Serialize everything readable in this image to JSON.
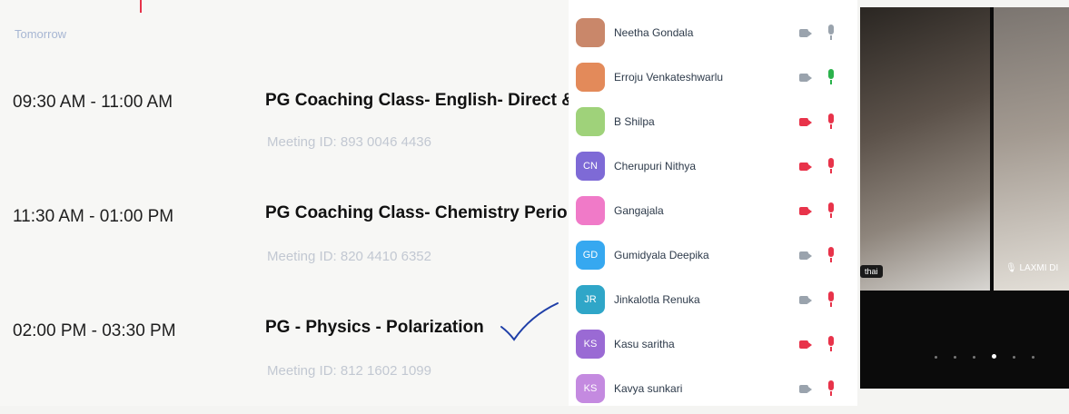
{
  "schedule": {
    "day_label": "Tomorrow",
    "meetings": [
      {
        "time": "09:30 AM - 11:00 AM",
        "title": "PG Coaching Class- English- Direct &",
        "meeting_id": "Meeting ID: 893 0046 4436"
      },
      {
        "time": "11:30 AM - 01:00 PM",
        "title": "PG Coaching Class- Chemistry Perio",
        "meeting_id": "Meeting ID: 820 4410 6352"
      },
      {
        "time": "02:00 PM - 03:30 PM",
        "title": "PG - Physics - Polarization",
        "meeting_id": "Meeting ID: 812 1602 1099"
      }
    ]
  },
  "participants": [
    {
      "name": "Neetha Gondala",
      "initials": "",
      "avatar_color": "#c9876a",
      "photo": true,
      "cam": "off",
      "mic": "off"
    },
    {
      "name": "Erroju Venkateshwarlu",
      "initials": "",
      "avatar_color": "#e38a5a",
      "photo": true,
      "cam": "off",
      "mic": "on"
    },
    {
      "name": "B Shilpa",
      "initials": "",
      "avatar_color": "#9fd27a",
      "photo": false,
      "cam": "muted",
      "mic": "muted"
    },
    {
      "name": "Cherupuri Nithya",
      "initials": "CN",
      "avatar_color": "#7e6ad6",
      "photo": false,
      "cam": "muted",
      "mic": "muted"
    },
    {
      "name": "Gangajala",
      "initials": "",
      "avatar_color": "#f07ac8",
      "photo": false,
      "cam": "muted",
      "mic": "muted"
    },
    {
      "name": "Gumidyala Deepika",
      "initials": "GD",
      "avatar_color": "#36a8f0",
      "photo": false,
      "cam": "off",
      "mic": "muted"
    },
    {
      "name": "Jinkalotla Renuka",
      "initials": "JR",
      "avatar_color": "#2fa6c8",
      "photo": false,
      "cam": "off",
      "mic": "muted"
    },
    {
      "name": "Kasu saritha",
      "initials": "KS",
      "avatar_color": "#9a6ad4",
      "photo": false,
      "cam": "muted",
      "mic": "muted"
    },
    {
      "name": "Kavya sunkari",
      "initials": "KS",
      "avatar_color": "#c48ae0",
      "photo": false,
      "cam": "off",
      "mic": "muted"
    }
  ],
  "video": {
    "tile1_name": "thai",
    "tile2_name": "LAXMI DI"
  },
  "colors": {
    "muted_red": "#e8334a",
    "on_green": "#2bb24c",
    "off_gray": "#9aa3ad",
    "check_blue": "#1f3fa8"
  }
}
